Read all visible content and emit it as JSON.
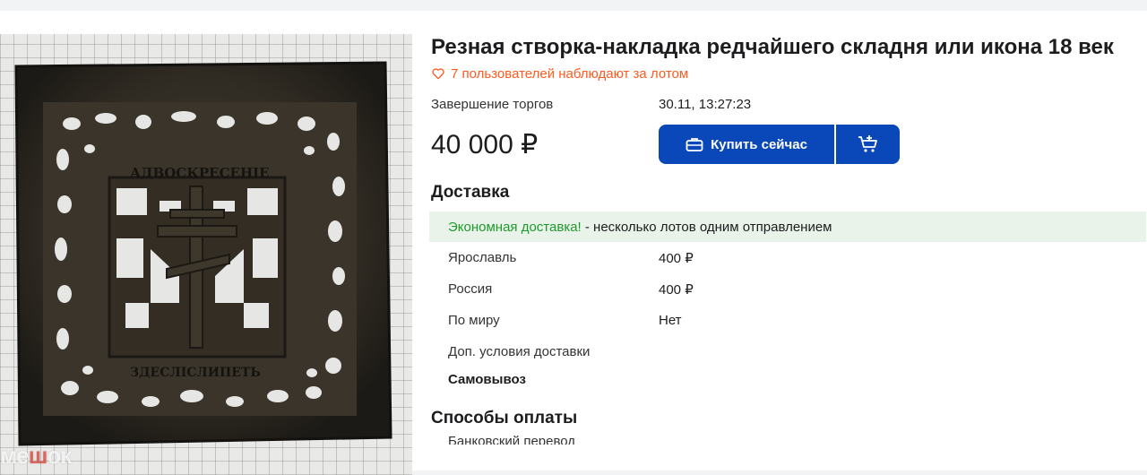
{
  "lot": {
    "title": "Резная створка-накладка редчайшего складня или икона 18 век",
    "watchers": "7 пользователей наблюдают за лотом",
    "end_label": "Завершение торгов",
    "end_value": "30.11, 13:27:23",
    "price": "40 000 ₽"
  },
  "actions": {
    "buy_now": "Купить сейчас",
    "buy_icon": "briefcase-icon",
    "cart_icon": "cart-add-icon"
  },
  "delivery": {
    "title": "Доставка",
    "promo_highlight": "Экономная доставка!",
    "promo_text": " - несколько лотов одним отправлением",
    "rows": [
      {
        "label": "Ярославль",
        "value": "400 ₽"
      },
      {
        "label": "Россия",
        "value": "400 ₽"
      },
      {
        "label": "По миру",
        "value": "Нет"
      }
    ],
    "extra_label": "Доп. условия доставки",
    "pickup": "Самовывоз"
  },
  "payment": {
    "title": "Способы оплаты",
    "first_item_partial": "Банковский перевод"
  },
  "photo": {
    "watermark_prefix": "ме",
    "watermark_mark": "ш",
    "watermark_suffix": "ок",
    "plate_text_top": "АДВОСКРЕСЕНІЕ",
    "plate_text_bottom": "ЗДЕСЛІСЛИПЕТЬ"
  },
  "colors": {
    "accent": "#0a47b8",
    "watchers": "#ff5a1f",
    "promo_green": "#1f9a2e",
    "promo_bg": "#e9f3e9"
  }
}
